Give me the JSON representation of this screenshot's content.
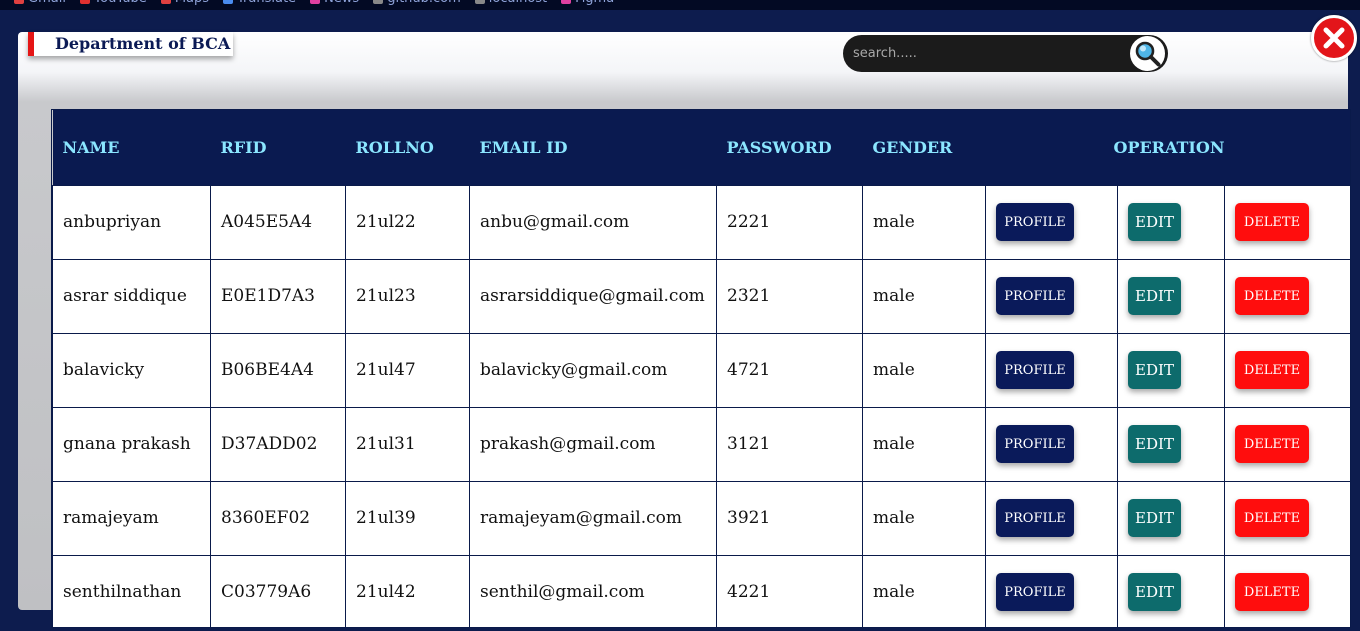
{
  "bookmarks": [
    {
      "label": "Gmail",
      "color": "#e04040"
    },
    {
      "label": "YouTube",
      "color": "#e03030"
    },
    {
      "label": "Maps",
      "color": "#e04040"
    },
    {
      "label": "Translate",
      "color": "#4a8cf0"
    },
    {
      "label": "News",
      "color": "#e040a0"
    },
    {
      "label": "github.com",
      "color": "#888888"
    },
    {
      "label": "localhost",
      "color": "#888888"
    },
    {
      "label": "Figma",
      "color": "#e040a0"
    }
  ],
  "header": {
    "department_title": "Department of BCA",
    "search_placeholder": "search....."
  },
  "icons": {
    "search": "magnifier-icon",
    "close": "close-x-icon"
  },
  "table": {
    "columns": [
      "NAME",
      "RFID",
      "ROLLNO",
      "EMAIL ID",
      "PASSWORD",
      "GENDER",
      "OPERATION"
    ],
    "buttons": {
      "profile": "PROFILE",
      "edit": "EDIT",
      "delete": "DELETE"
    },
    "rows": [
      {
        "name": "anbupriyan",
        "rfid": "A045E5A4",
        "rollno": "21ul22",
        "email": "anbu@gmail.com",
        "password": "2221",
        "gender": "male"
      },
      {
        "name": "asrar siddique",
        "rfid": "E0E1D7A3",
        "rollno": "21ul23",
        "email": "asrarsiddique@gmail.com",
        "password": "2321",
        "gender": "male"
      },
      {
        "name": "balavicky",
        "rfid": "B06BE4A4",
        "rollno": "21ul47",
        "email": "balavicky@gmail.com",
        "password": "4721",
        "gender": "male"
      },
      {
        "name": "gnana prakash",
        "rfid": "D37ADD02",
        "rollno": "21ul31",
        "email": "prakash@gmail.com",
        "password": "3121",
        "gender": "male"
      },
      {
        "name": "ramajeyam",
        "rfid": "8360EF02",
        "rollno": "21ul39",
        "email": "ramajeyam@gmail.com",
        "password": "3921",
        "gender": "male"
      },
      {
        "name": "senthilnathan",
        "rfid": "C03779A6",
        "rollno": "21ul42",
        "email": "senthil@gmail.com",
        "password": "4221",
        "gender": "male"
      }
    ]
  },
  "colors": {
    "page_bg": "#0d1c4e",
    "header_bg": "#0a1a50",
    "header_text": "#8be6ff",
    "profile_btn": "#0a1a5a",
    "edit_btn": "#0d6b6c",
    "delete_btn": "#ff0d0d",
    "close_btn": "#e3151a",
    "accent": "#e51515"
  }
}
